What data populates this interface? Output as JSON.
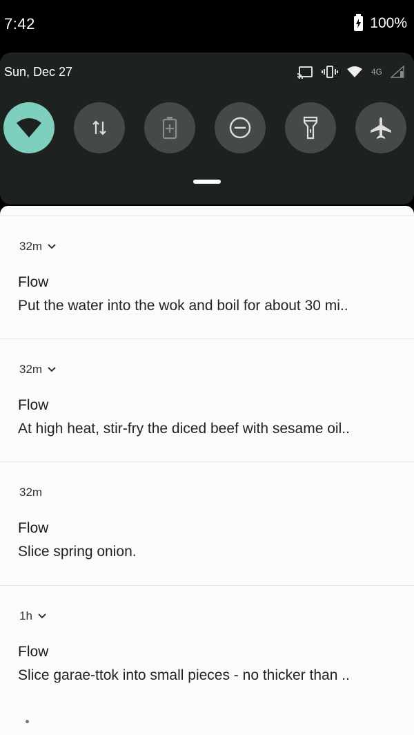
{
  "status_bar": {
    "time": "7:42",
    "battery": "100%"
  },
  "quick_settings": {
    "date": "Sun, Dec 27",
    "network_label": "4G",
    "tiles": [
      {
        "icon": "wifi-icon",
        "active": true
      },
      {
        "icon": "data-transfer-icon",
        "active": false
      },
      {
        "icon": "battery-saver-icon",
        "active": false
      },
      {
        "icon": "do-not-disturb-icon",
        "active": false
      },
      {
        "icon": "flashlight-icon",
        "active": false
      },
      {
        "icon": "airplane-icon",
        "active": false
      }
    ]
  },
  "notifications": [
    {
      "time": "32m",
      "expandable": true,
      "app": "Flow",
      "text": "Put the water into the wok and boil for about 30 mi.."
    },
    {
      "time": "32m",
      "expandable": true,
      "app": "Flow",
      "text": "At high heat, stir-fry the diced beef with sesame oil.."
    },
    {
      "time": "32m",
      "expandable": false,
      "app": "Flow",
      "text": "Slice spring onion."
    },
    {
      "time": "1h",
      "expandable": true,
      "app": "Flow",
      "text": "Slice garae-ttok into small pieces - no thicker than .."
    }
  ]
}
